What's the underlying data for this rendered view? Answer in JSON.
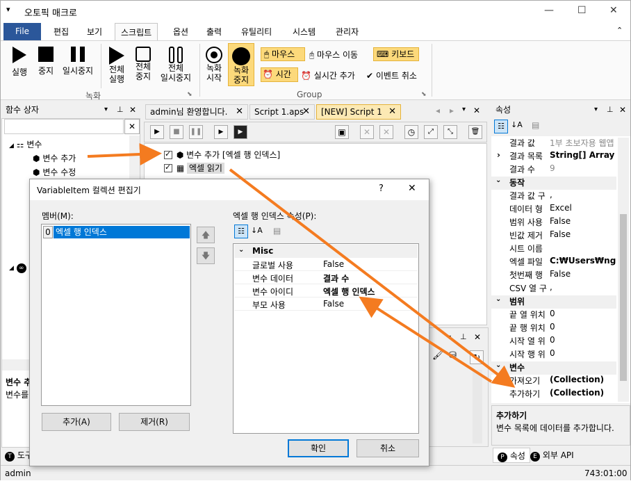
{
  "app": {
    "title": "오토픽 매크로",
    "menu_glyph": "▾"
  },
  "window_controls": {
    "minimize": "—",
    "maximize": "☐",
    "close": "✕"
  },
  "ribbon_tabs": [
    "File",
    "편집",
    "보기",
    "스크립트",
    "옵션",
    "출력",
    "유틸리티",
    "시스템",
    "관리자"
  ],
  "ribbon_collapse": "⌃",
  "ribbon": {
    "run": "실행",
    "stop": "중지",
    "pause": "일시중지",
    "run_all": [
      "전체",
      "실행"
    ],
    "stop_all": [
      "전체",
      "중지"
    ],
    "pause_all": [
      "전체",
      "일시중지"
    ],
    "rec_start": [
      "녹화",
      "시작"
    ],
    "rec_stop": [
      "녹화",
      "중지"
    ],
    "group_record": "녹화",
    "mouse": "마우스",
    "mouse_move": "마우스 이동",
    "keyboard": "키보드",
    "time": "시간",
    "realtime_add": "실시간 추가",
    "event_cancel": "이벤트 취소",
    "group_group": "Group"
  },
  "left_pane": {
    "title": "함수 상자",
    "search_placeholder": "",
    "clear": "✕",
    "tree": {
      "root": "변수",
      "add": "변수 추가",
      "edit": "변수 수정"
    },
    "desc_title": "변수 추",
    "desc_text": "변수를",
    "bottom_tab": "도구"
  },
  "doc_tabs": [
    {
      "label": "admin님 환영합니다.",
      "close": "✕"
    },
    {
      "label": "Script 1.aps",
      "close": "✕"
    },
    {
      "label": "[NEW] Script 1",
      "close": "✕"
    }
  ],
  "script_lines": [
    {
      "text": "변수 추가 [엑셀 행 인덱스]"
    },
    {
      "text": "엑셀 읽기"
    }
  ],
  "properties": {
    "title": "속성",
    "rows_top": [
      {
        "k": "결과 값",
        "v": "1부 초보자용 웹앱"
      },
      {
        "k": "결과 목록",
        "v": "String[] Array"
      },
      {
        "k": "결과 수",
        "v": "9"
      }
    ],
    "cat_action": "동작",
    "rows_action": [
      {
        "k": "결과 값 구",
        "v": ","
      },
      {
        "k": "데이터 형",
        "v": "Excel"
      },
      {
        "k": "범위 사용",
        "v": "False"
      },
      {
        "k": "빈값 제거",
        "v": "False"
      },
      {
        "k": "시트 이름",
        "v": ""
      },
      {
        "k": "엑셀 파일",
        "v": "C:₩Users₩ngma"
      },
      {
        "k": "첫번째 행",
        "v": "False"
      },
      {
        "k": "CSV 열 구",
        "v": ","
      }
    ],
    "cat_range": "범위",
    "rows_range": [
      {
        "k": "끝 열 위치",
        "v": "0"
      },
      {
        "k": "끝 행 위치",
        "v": "0"
      },
      {
        "k": "시작 열 위",
        "v": "0"
      },
      {
        "k": "시작 행 위",
        "v": "0"
      }
    ],
    "cat_var": "변수",
    "rows_var": [
      {
        "k": "가져오기",
        "v": "(Collection)"
      },
      {
        "k": "추가하기",
        "v": "(Collection)"
      }
    ],
    "desc_title": "추가하기",
    "desc_text": "변수 목록에 데이터를 추가합니다.",
    "tab_props": "속성",
    "tab_api": "외부 API"
  },
  "dialog": {
    "title": "VariableItem 컬렉션 편집기",
    "help": "?",
    "close": "✕",
    "members_label": "멤버(M):",
    "member_index": "0",
    "member_name": "엑셀 행 인덱스",
    "props_label": "엑셀 행 인덱스 속성(P):",
    "category": "Misc",
    "rows": [
      {
        "k": "글로벌 사용",
        "v": "False",
        "bold": false
      },
      {
        "k": "변수 데이터",
        "v": "결과 수",
        "bold": true
      },
      {
        "k": "변수 아이디",
        "v": "엑셀 행 인덱스",
        "bold": true
      },
      {
        "k": "부모 사용",
        "v": "False",
        "bold": false
      }
    ],
    "add_button": "추가(A)",
    "remove_button": "제거(R)",
    "ok_button": "확인",
    "cancel_button": "취소"
  },
  "status": {
    "user": "admin",
    "time": "743:01:00"
  },
  "colors": {
    "accent": "#2b579a",
    "highlight": "#fcd97b",
    "arrow": "#f47b20",
    "selection": "#0078d7"
  }
}
